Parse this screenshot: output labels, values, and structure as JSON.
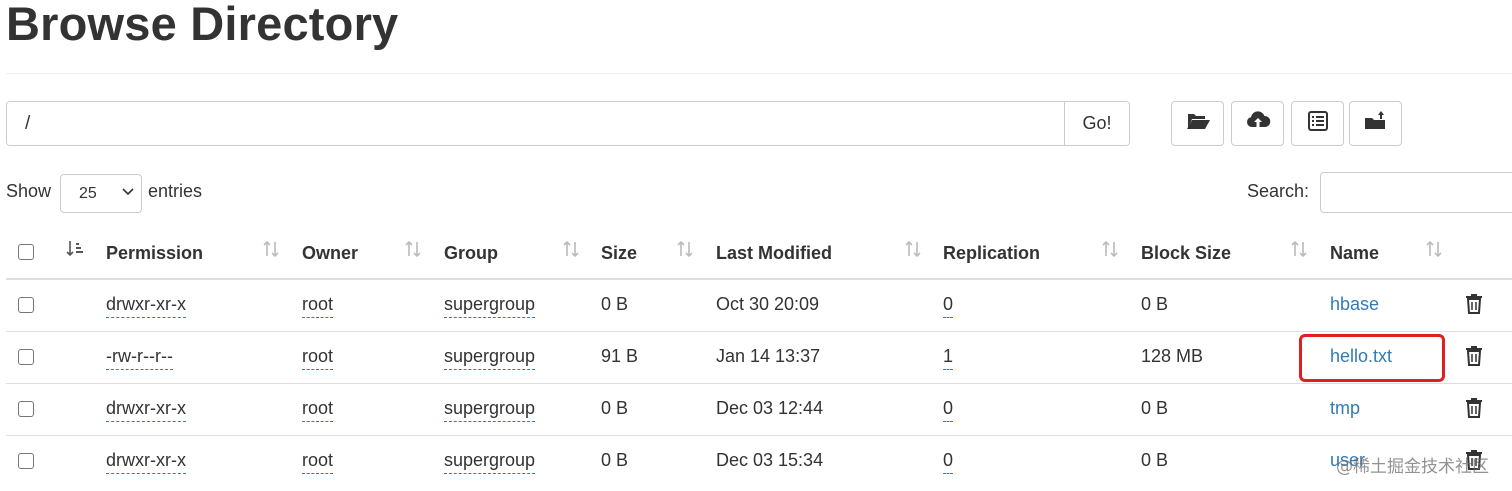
{
  "page": {
    "title": "Browse Directory"
  },
  "path_bar": {
    "value": "/",
    "go_label": "Go!"
  },
  "toolbar": {
    "buttons": [
      {
        "icon": "folder-open-icon"
      },
      {
        "icon": "cloud-upload-icon"
      },
      {
        "icon": "list-alt-icon"
      },
      {
        "icon": "folder-cut-icon"
      }
    ]
  },
  "table_controls": {
    "show_label": "Show",
    "entries_per_page": "25",
    "entries_label": "entries",
    "search_label": "Search:"
  },
  "table": {
    "columns": [
      "Permission",
      "Owner",
      "Group",
      "Size",
      "Last Modified",
      "Replication",
      "Block Size",
      "Name"
    ],
    "rows": [
      {
        "permission": "drwxr-xr-x",
        "owner": "root",
        "group": "supergroup",
        "size": "0 B",
        "last_modified": "Oct 30 20:09",
        "replication": "0",
        "block_size": "0 B",
        "name": "hbase"
      },
      {
        "permission": "-rw-r--r--",
        "owner": "root",
        "group": "supergroup",
        "size": "91 B",
        "last_modified": "Jan 14 13:37",
        "replication": "1",
        "block_size": "128 MB",
        "name": "hello.txt"
      },
      {
        "permission": "drwxr-xr-x",
        "owner": "root",
        "group": "supergroup",
        "size": "0 B",
        "last_modified": "Dec 03 12:44",
        "replication": "0",
        "block_size": "0 B",
        "name": "tmp"
      },
      {
        "permission": "drwxr-xr-x",
        "owner": "root",
        "group": "supergroup",
        "size": "0 B",
        "last_modified": "Dec 03 15:34",
        "replication": "0",
        "block_size": "0 B",
        "name": "user"
      }
    ]
  },
  "watermark": "@稀土掘金技术社区",
  "colors": {
    "link": "#337ab7",
    "highlight": "#e02020",
    "border": "#cccccc"
  }
}
